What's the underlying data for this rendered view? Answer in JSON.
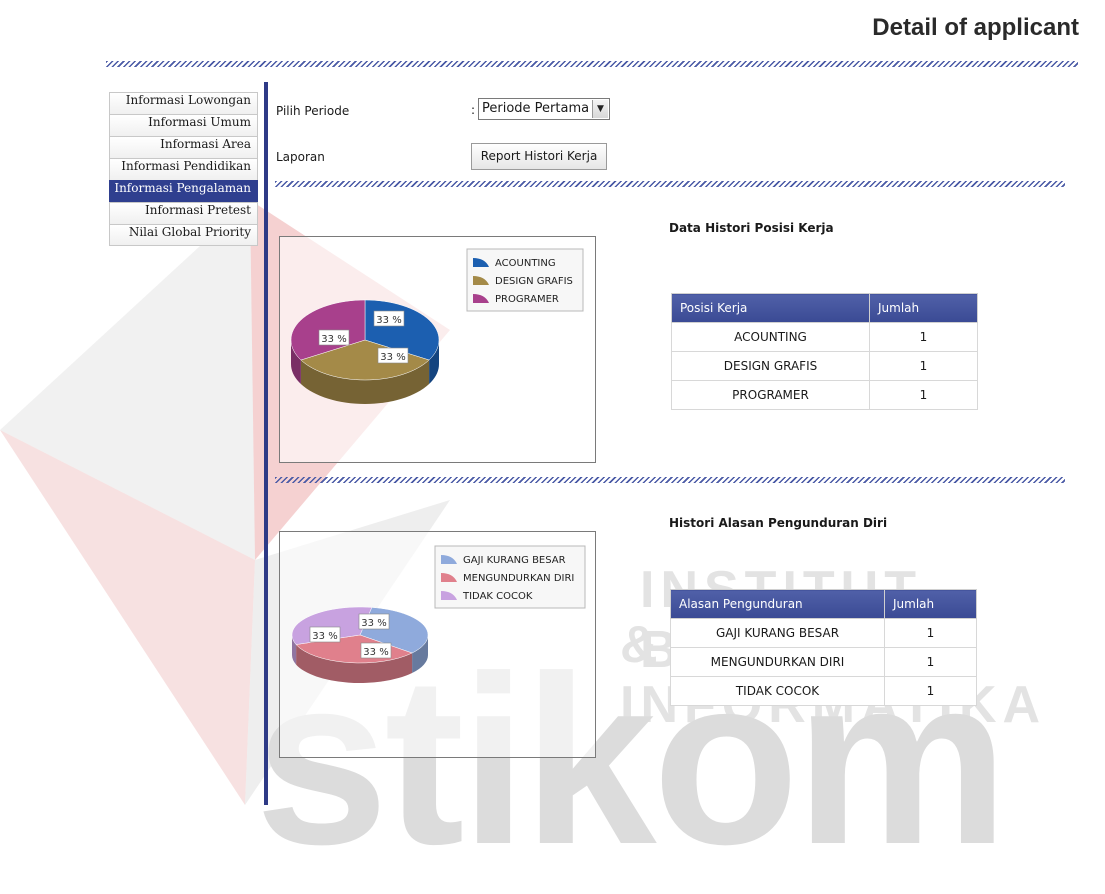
{
  "header": {
    "title": "Detail of applicant"
  },
  "watermark": {
    "line1": "INSTITUT BISNIS",
    "line2": "& INFORMATIKA",
    "logo_text": "stikom"
  },
  "sidebar": {
    "items": [
      {
        "label": "Informasi Lowongan",
        "active": false
      },
      {
        "label": "Informasi Umum",
        "active": false
      },
      {
        "label": "Informasi Area",
        "active": false
      },
      {
        "label": "Informasi Pendidikan",
        "active": false
      },
      {
        "label": "Informasi Pengalaman",
        "active": true
      },
      {
        "label": "Informasi Pretest",
        "active": false
      },
      {
        "label": "Nilai Global Priority",
        "active": false
      }
    ]
  },
  "form": {
    "periode_label": "Pilih Periode",
    "colon": ":",
    "periode_value": "Periode Pertama",
    "laporan_label": "Laporan",
    "report_button": "Report Histori Kerja"
  },
  "section1": {
    "title": "Data Histori Posisi Kerja",
    "columns": [
      "Posisi Kerja",
      "Jumlah"
    ],
    "rows": [
      [
        "ACOUNTING",
        "1"
      ],
      [
        "DESIGN GRAFIS",
        "1"
      ],
      [
        "PROGRAMER",
        "1"
      ]
    ]
  },
  "section2": {
    "title": "Histori Alasan Pengunduran Diri",
    "columns": [
      "Alasan Pengunduran",
      "Jumlah"
    ],
    "rows": [
      [
        "GAJI KURANG BESAR",
        "1"
      ],
      [
        "MENGUNDURKAN DIRI",
        "1"
      ],
      [
        "TIDAK COCOK",
        "1"
      ]
    ]
  },
  "chart_data": [
    {
      "type": "pie",
      "labels": [
        "ACOUNTING",
        "DESIGN GRAFIS",
        "PROGRAMER"
      ],
      "values": [
        1,
        1,
        1
      ],
      "percent_labels": [
        "33 %",
        "33 %",
        "33 %"
      ],
      "colors": [
        "#1c5fb0",
        "#a48a48",
        "#a8408c"
      ],
      "legend": "top-right"
    },
    {
      "type": "pie",
      "labels": [
        "GAJI KURANG BESAR",
        "MENGUNDURKAN DIRI",
        "TIDAK COCOK"
      ],
      "values": [
        1,
        1,
        1
      ],
      "percent_labels": [
        "33 %",
        "33 %",
        "33 %"
      ],
      "colors": [
        "#8faadc",
        "#e0808c",
        "#c8a2e0"
      ],
      "legend": "top-right"
    }
  ]
}
